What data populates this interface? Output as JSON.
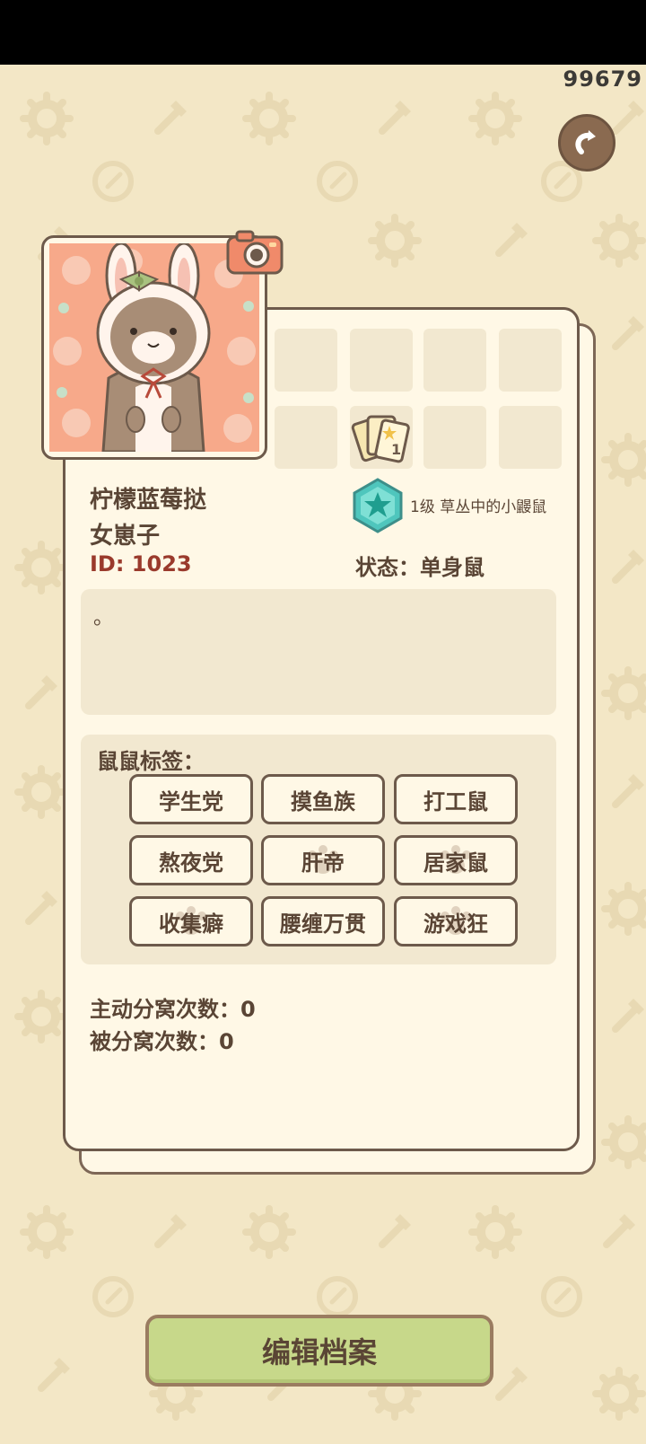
{
  "topbar": {
    "counter": "99679"
  },
  "icons": {
    "back": "back-arrow-icon",
    "camera": "camera-icon",
    "level": "star-badge-icon",
    "cards": "cards-icon"
  },
  "profile": {
    "name": "柠檬蓝莓挞",
    "title": "女崽子",
    "id": "ID: 1023",
    "level": "1级 草丛中的小鼹鼠",
    "status": "状态：单身鼠",
    "bio": "。"
  },
  "tags": {
    "title": "鼠鼠标签：",
    "items": [
      "学生党",
      "摸鱼族",
      "打工鼠",
      "熬夜党",
      "肝帝",
      "居家鼠",
      "收集癖",
      "腰缠万贯",
      "游戏狂"
    ]
  },
  "stats": {
    "active": "主动分窝次数：0",
    "passive": "被分窝次数：0"
  },
  "edit_button": "编辑档案",
  "colors": {
    "background": "#f3e7c6",
    "card": "#fff8e6",
    "border": "#6d5a4b",
    "button": "#c7d88a",
    "id_text": "#9a3a2c"
  }
}
